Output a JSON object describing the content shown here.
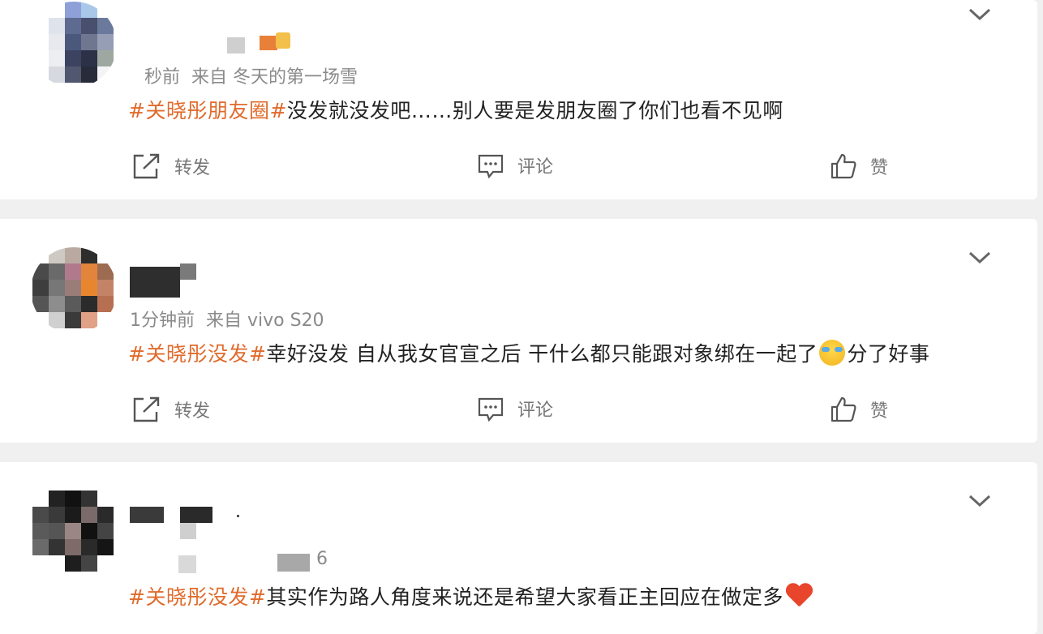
{
  "posts": [
    {
      "meta_time": "秒前",
      "meta_from": "来自 冬天的第一场雪",
      "topic": "#关晓彤朋友圈#",
      "text": "没发就没发吧……别人要是发朋友圈了你们也看不见啊"
    },
    {
      "meta_time": "1分钟前",
      "meta_from": "来自 vivo S20",
      "topic": "#关晓彤没发#",
      "text": "幸好没发 自从我女官宣之后 干什么都只能跟对象绑在一起了",
      "text_after_emoji": "分了好事"
    },
    {
      "meta_partial": "6",
      "topic": "#关晓彤没发#",
      "text": "其实作为路人角度来说还是希望大家看正主回应在做定多"
    }
  ],
  "actions": {
    "repost": "转发",
    "comment": "评论",
    "like": "赞"
  },
  "icons": {
    "repost": "repost-icon",
    "comment": "comment-icon",
    "like": "thumbs-up-icon",
    "menu": "chevron-down-icon"
  },
  "colors": {
    "topic": "#e06b2c",
    "text": "#222222",
    "meta": "#8a8a8a",
    "action": "#777777",
    "background": "#f0f0f0"
  }
}
